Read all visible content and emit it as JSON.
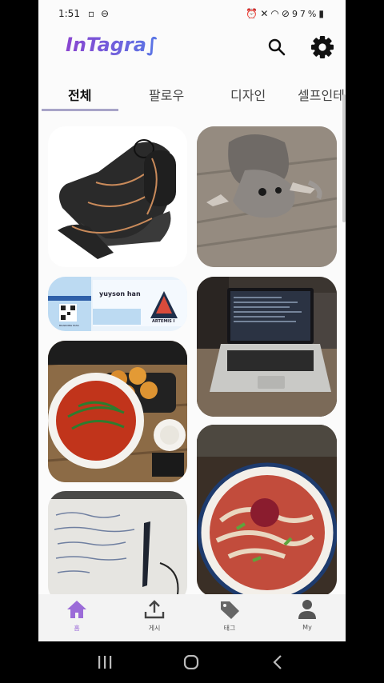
{
  "status_bar": {
    "time": "1:51",
    "battery": "97%"
  },
  "app": {
    "logo": "InTagra∫"
  },
  "tabs": [
    {
      "label": "전체",
      "active": true
    },
    {
      "label": "팔로우",
      "active": false
    },
    {
      "label": "디자인",
      "active": false
    },
    {
      "label": "셀프인테",
      "active": false
    }
  ],
  "feed": [
    {
      "subject": "massage-chair"
    },
    {
      "subject": "dog"
    },
    {
      "subject": "boarding-pass",
      "name": "yuyson han",
      "badge": "ARTEMIS I",
      "footer": "BOARDING PASS"
    },
    {
      "subject": "laptop"
    },
    {
      "subject": "noodle-soup"
    },
    {
      "subject": "notebook"
    },
    {
      "subject": "spicy-noodles"
    }
  ],
  "bottom_nav": [
    {
      "label": "홈",
      "icon": "home-icon",
      "active": true
    },
    {
      "label": "게시",
      "icon": "upload-icon",
      "active": false
    },
    {
      "label": "태그",
      "icon": "tag-icon",
      "active": false
    },
    {
      "label": "My",
      "icon": "person-icon",
      "active": false
    }
  ],
  "colors": {
    "accent": "#9b6bd8",
    "background": "#fbfbfb",
    "tab_indicator": "#a8a4c8"
  }
}
